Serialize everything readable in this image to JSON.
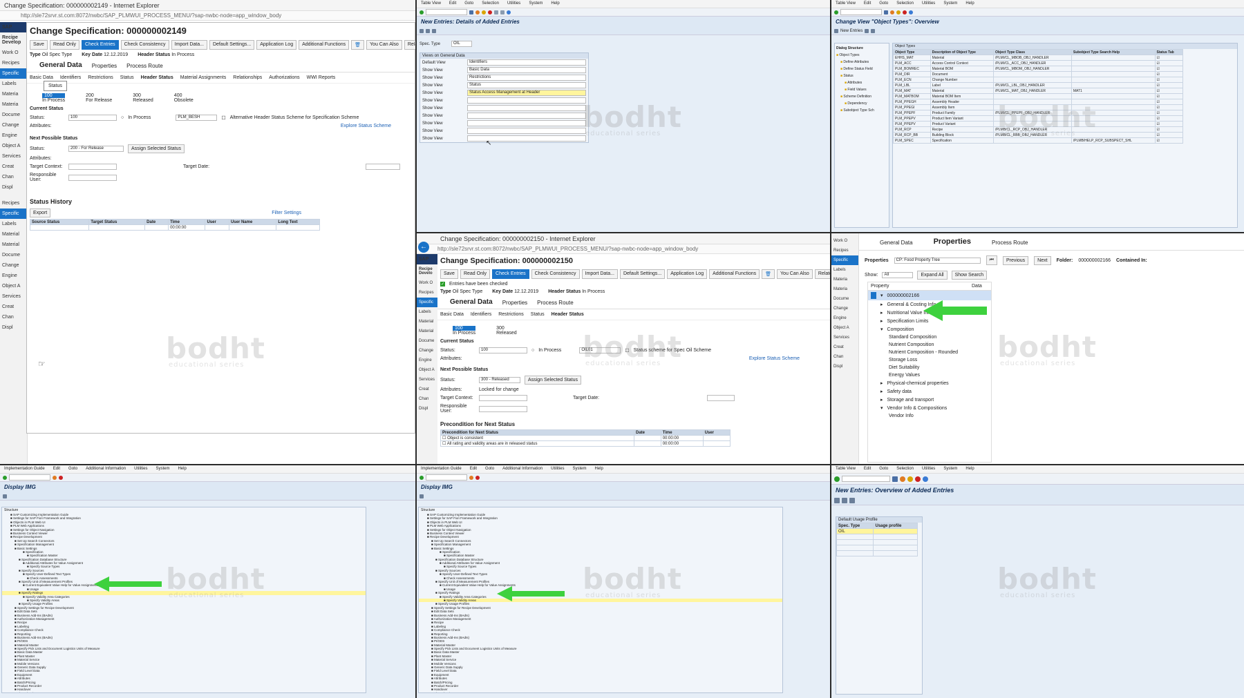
{
  "panel1": {
    "window_title": "Change Specification: 000000002149 - Internet Explorer",
    "address": "http://sle72srvr.st.com:8072/nwbc/SAP_PLMWUI_PROCESS_MENU/?sap-nwbc-node=app_window_body",
    "page_title": "Change Specification: 000000002149",
    "toolbar": [
      "Save",
      "Read Only",
      "Check Entries",
      "Check Consistency",
      "Import Data...",
      "Default Settings...",
      "Application Log",
      "Additional Functions",
      "You Can Also",
      "Related Links"
    ],
    "type_label": "Type",
    "type_value": "Oil Spec Type",
    "keydate_label": "Key Date",
    "keydate_value": "12.12.2019",
    "header_status_label": "Header Status",
    "header_status_value": "In Process",
    "main_tabs": [
      "General Data",
      "Properties",
      "Process Route"
    ],
    "sub_tabs": [
      "Basic Data",
      "Identifiers",
      "Restrictions",
      "Status",
      "Header Status",
      "Material Assignments",
      "Relationships",
      "Authorizations",
      "WWI Reports"
    ],
    "tooltip": "Status",
    "progress": [
      {
        "n": "100",
        "label": "In Process"
      },
      {
        "n": "200",
        "label": "For Release"
      },
      {
        "n": "300",
        "label": "Released"
      },
      {
        "n": "400",
        "label": "Obsolete"
      }
    ],
    "current_status_title": "Current Status",
    "status_label": "Status:",
    "status_value": "100",
    "status_text": "In Process",
    "scheme_value": "PLM_BESH",
    "scheme_text": "Alternative Header Status Scheme for Specification Scheme",
    "attributes_label": "Attributes:",
    "explore_link": "Explore Status Scheme",
    "next_title": "Next Possible Status",
    "next_value": "200 - For Release",
    "assign_btn": "Assign Selected Status",
    "target_context": "Target Context:",
    "target_date": "Target Date:",
    "responsible": "Responsible User:",
    "history_title": "Status History",
    "export": "Export",
    "filter": "Filter Settings",
    "history_cols": [
      "Source Status",
      "Target Status",
      "Date",
      "Time",
      "User",
      "User Name",
      "Long Text"
    ],
    "history_time": "00:00:00",
    "sidenav": [
      "Recipe Develop",
      "Work O",
      "Recipes",
      "Specific",
      "Labels",
      "Materia",
      "Materia",
      "Docume",
      "Change",
      "Engine",
      "Object A",
      "Services",
      "Creat",
      "Chan",
      "Displ",
      "Recipes",
      "Specific",
      "Labels",
      "Material",
      "Material",
      "Docume",
      "Change",
      "Engine",
      "Object A",
      "Services",
      "Creat",
      "Chan",
      "Displ"
    ]
  },
  "panel2": {
    "menu": [
      "Table View",
      "Edit",
      "Goto",
      "Selection",
      "Utilities",
      "System",
      "Help"
    ],
    "title": "New Entries: Details of Added Entries",
    "spec_label": "Spec. Type",
    "spec_value": "OIL",
    "views_title": "Views on General Data",
    "default_view": "Default View",
    "show_view": "Show View",
    "views": [
      "Identifiers",
      "Basic Data",
      "Restrictions",
      "Status",
      "Status Access Management at Header",
      "",
      "",
      "",
      "",
      "",
      ""
    ]
  },
  "panel3": {
    "menu": [
      "Table View",
      "Edit",
      "Goto",
      "Selection",
      "Utilities",
      "System",
      "Help"
    ],
    "title": "Change View \"Object Types\": Overview",
    "new_entries": "New Entries",
    "dialog_title": "Dialog Structure",
    "tree": [
      "Object Types",
      "Define Attributes",
      "Define Status Field",
      "Status",
      "Attributes",
      "Field Values",
      "Scheme Definition",
      "Dependency",
      "Subobject Type Sch"
    ],
    "table_title": "Object Types",
    "cols": [
      "Object Type",
      "Description of Object Type",
      "Object Type Class",
      "Subobject Type Search Help",
      "Status Tab"
    ],
    "rows": [
      [
        "EHHS_MAT",
        "Material",
        "/PLMI/CL_MBOB_OBJ_HANDLER",
        ""
      ],
      [
        "PLM_ACC",
        "Access Control Context",
        "/PLMI/CL_ACC_OBJ_HANDLER",
        ""
      ],
      [
        "PLM_BOMREC",
        "Material BOM",
        "/PLMI/CL_MBOM_OBJ_HANDLER",
        ""
      ],
      [
        "PLM_DIR",
        "Document",
        "",
        ""
      ],
      [
        "PLM_ECN",
        "Change Number",
        "",
        ""
      ],
      [
        "PLM_LBL",
        "Label",
        "/PLMI/CL_LBL_OBJ_HANDLER",
        ""
      ],
      [
        "PLM_MAT",
        "Material",
        "/PLMI/CL_MAT_OBJ_HANDLER",
        "MAT1"
      ],
      [
        "PLM_MATBOM",
        "Material BOM Item",
        "",
        ""
      ],
      [
        "PLM_PPEGH",
        "Assembly Header",
        "",
        ""
      ],
      [
        "PLM_PPEGI",
        "Assembly Item",
        "",
        ""
      ],
      [
        "PLM_PPEPF",
        "Product Family",
        "/PLMI/CL_PPEPF_OBJ_HANDLER",
        ""
      ],
      [
        "PLM_PPEPV",
        "Product Item Variant",
        "",
        ""
      ],
      [
        "PLM_PPEPV",
        "Product Variant",
        "",
        ""
      ],
      [
        "PLM_RCP",
        "Recipe",
        "/PLMB/CL_RCP_OBJ_HANDLER",
        ""
      ],
      [
        "PLM_RCP_BB",
        "Building Block",
        "/PLMB/CL_RBB_OBJ_HANDLER",
        ""
      ],
      [
        "PLM_SPEC",
        "Specification",
        "",
        "/PLMB/HELP_RCP_SUBSPECT_SHL"
      ]
    ]
  },
  "panel4": {
    "window_title": "Change Specification: 000000002150 - Internet Explorer",
    "address": "http://sle72srvr.st.com:8072/nwbc/SAP_PLMWUI_PROCESS_MENU/?sap-nwbc-node=app_window_body",
    "page_title": "Change Specification: 000000002150",
    "toolbar": [
      "Save",
      "Read Only",
      "Check Entries",
      "Check Consistency",
      "Import Data...",
      "Default Settings...",
      "Application Log",
      "Additional Functions",
      "You Can Also",
      "Related Links"
    ],
    "message": "Entries have been checked",
    "type_label": "Type",
    "type_value": "Oil Spec Type",
    "keydate_label": "Key Date",
    "keydate_value": "12.12.2019",
    "header_status_label": "Header Status",
    "header_status_value": "In Process",
    "main_tabs": [
      "General Data",
      "Properties",
      "Process Route"
    ],
    "sub_tabs": [
      "Basic Data",
      "Identifiers",
      "Restrictions",
      "Status",
      "Header Status"
    ],
    "progress": [
      {
        "n": "100",
        "label": "In Process"
      },
      {
        "n": "300",
        "label": "Released"
      }
    ],
    "current_status_title": "Current Status",
    "status_label": "Status:",
    "status_value": "100",
    "status_text": "In Process",
    "scheme_value": "OIL01",
    "scheme_text": "Status scheme for Spec Oil Scheme",
    "attributes_label": "Attributes:",
    "explore_link": "Explore Status Scheme",
    "next_title": "Next Possible Status",
    "next_value": "300 - Released",
    "assign_btn": "Assign Selected Status",
    "locked": "Locked for change",
    "target_context": "Target Context:",
    "target_date": "Target Date:",
    "responsible": "Responsible User:",
    "pre_title": "Precondition for Next Status",
    "pre_cols": [
      "Precondition for Next Status",
      "Date",
      "Time",
      "User"
    ],
    "pre_rows": [
      {
        "text": "Object is consistent",
        "time": "00:00:00"
      },
      {
        "text": "All rating and validity areas are in released status",
        "time": "00:00:00"
      }
    ],
    "sidenav": [
      "Recipe Develo",
      "Work O",
      "Recipes",
      "Specific",
      "Labels",
      "Material",
      "Material",
      "Docume",
      "Change",
      "Engine",
      "Object A",
      "Services",
      "Creat",
      "Chan",
      "Displ"
    ]
  },
  "panel5": {
    "tab_general": "General Data",
    "tab_properties": "Properties",
    "tab_route": "Process Route",
    "properties_label": "Properties",
    "properties_value": "CP: Food Property Tree",
    "previous": "Previous",
    "next": "Next",
    "folder_label": "Folder:",
    "folder_value": "000000002166",
    "contained": "Contained In:",
    "show_label": "Show:",
    "show_value": "All",
    "expand": "Expand All",
    "show_search": "Show Search",
    "col_property": "Property",
    "col_data": "Data",
    "root": "000000002166",
    "tree": [
      {
        "t": "General & Costing Info",
        "l": 1,
        "e": "c"
      },
      {
        "t": "Nutritional Value Information",
        "l": 1,
        "e": "c"
      },
      {
        "t": "Specification Limits",
        "l": 1,
        "e": "c"
      },
      {
        "t": "Composition",
        "l": 1,
        "e": "o"
      },
      {
        "t": "Standard Composition",
        "l": 2,
        "e": ""
      },
      {
        "t": "Nutrient Composition",
        "l": 2,
        "e": ""
      },
      {
        "t": "Nutrient Composition - Rounded",
        "l": 2,
        "e": ""
      },
      {
        "t": "Storage Loss",
        "l": 2,
        "e": ""
      },
      {
        "t": "Diet Suitability",
        "l": 2,
        "e": ""
      },
      {
        "t": "Energy Values",
        "l": 2,
        "e": ""
      },
      {
        "t": "Physical-chemical properties",
        "l": 1,
        "e": "c"
      },
      {
        "t": "Safety data",
        "l": 1,
        "e": "c"
      },
      {
        "t": "Storage and transport",
        "l": 1,
        "e": "c"
      },
      {
        "t": "Vendor Info & Compositions",
        "l": 1,
        "e": "o"
      },
      {
        "t": "Vendor Info",
        "l": 2,
        "e": ""
      }
    ],
    "sidenav": [
      "Work O",
      "Recipes",
      "Specific",
      "Labels",
      "Materia",
      "Materia",
      "Docume",
      "Change",
      "Engine",
      "Object A",
      "Services",
      "Creat",
      "Chan",
      "Displ"
    ]
  },
  "panel6": {
    "menu": [
      "Implementation Guide",
      "Edit",
      "Goto",
      "Additional Information",
      "Utilities",
      "System",
      "Help"
    ],
    "title": "Display IMG",
    "structure": "Structure",
    "tree": [
      "SAP Customizing Implementation Guide",
      "Settings for SAP Fiori Framework and Integration",
      "Objects in PLM Web UI",
      "PLM Web Applications",
      "Settings for Object Navigation",
      "Business Context Viewer",
      "Recipe Development",
      "Set Up Search Connectors",
      "Specification Management",
      "Basic Settings",
      "Specification",
      "Specification Master",
      "Specification Database Structure",
      "Additional Attributes for Value Assignment",
      "Specify Source Types",
      "Specify Sources",
      "Specify User-Defined Text Types",
      "Check Assessments",
      "Specify Unit of Measurement Profiles",
      "Current Equivalent Value Help for Value Assignments",
      "Usage",
      "Specify Ratings",
      "Specify Validity Area Categories",
      "Specify Validity Areas",
      "Specify Usage Profiles",
      "Specify Settings for Recipe Development",
      "Edit Data Sets",
      "Business Add-Ins (BAdIs)",
      "Authorization Management",
      "Recipe",
      "Labeling",
      "Compliance Check",
      "Reporting",
      "Business Add-Ins (BAdIs)",
      "PI/ODS",
      "Material Master",
      "Specify Pick Lists and Document Logistics Units of Measure",
      "Basic Data Master",
      "Plant Master",
      "Material Service",
      "Mobile Versions",
      "Generic Data Supply",
      "Field Level Data",
      "Equipment",
      "Attributes",
      "Batch/Pricing",
      "Product Recorder",
      "Handover",
      "Flow Planning"
    ]
  },
  "panel7": {
    "menu": [
      "Implementation Guide",
      "Edit",
      "Goto",
      "Additional Information",
      "Utilities",
      "System",
      "Help"
    ],
    "title": "Display IMG",
    "structure": "Structure"
  },
  "panel8": {
    "menu": [
      "Table View",
      "Edit",
      "Goto",
      "Selection",
      "Utilities",
      "System",
      "Help"
    ],
    "title": "New Entries: Overview of Added Entries",
    "table_title": "Default Usage Profile",
    "col_spec": "Spec. Type",
    "col_usage": "Usage profile",
    "spec_value": "OIL"
  },
  "watermark": "bodht",
  "watermark_sub": "educational series",
  "colors": {
    "sap_blue": "#1a73c8",
    "arrow_green": "#3ed13e",
    "sap_bg": "#e6eef7",
    "highlight": "#fff59d"
  }
}
